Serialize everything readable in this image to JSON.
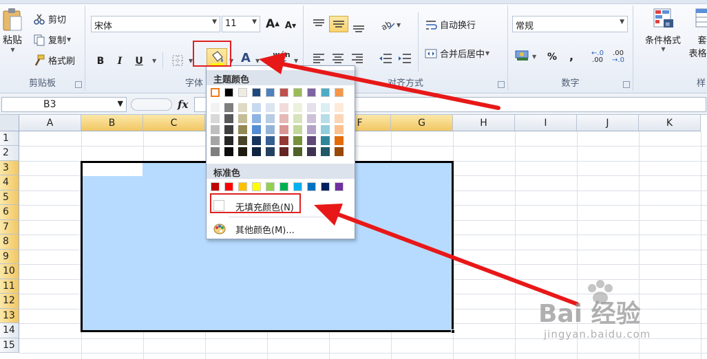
{
  "clipboard": {
    "paste_label": "粘贴",
    "cut_label": "剪切",
    "copy_label": "复制",
    "format_painter_label": "格式刷",
    "group_label": "剪贴板"
  },
  "font_group": {
    "font_name": "宋体",
    "font_size": "11",
    "bold_label": "B",
    "italic_label": "I",
    "underline_label": "U",
    "font_color_label": "A",
    "phonetic_label": "wén",
    "grow_font_label": "A",
    "shrink_font_label": "A",
    "group_label": "字体"
  },
  "alignment_group": {
    "wrap_text_label": "自动换行",
    "merge_center_label": "合并后居中",
    "group_label": "对齐方式"
  },
  "number_group": {
    "format_value": "常规",
    "percent_label": "%",
    "comma_label": ",",
    "inc_decimal_label": ".00",
    "dec_decimal_label": ".00",
    "group_label": "数字"
  },
  "styles_group": {
    "conditional_format_label": "条件格式",
    "table_format_label_1": "套",
    "table_format_label_2": "表格格",
    "group_label": "样"
  },
  "formula_bar": {
    "name_box_value": "B3",
    "fx_label": "fx"
  },
  "grid": {
    "columns": [
      "A",
      "B",
      "C",
      "D",
      "E",
      "F",
      "G",
      "H",
      "I",
      "J",
      "K"
    ],
    "rows": [
      "1",
      "2",
      "3",
      "4",
      "5",
      "6",
      "7",
      "8",
      "9",
      "10",
      "11",
      "12",
      "13",
      "14",
      "15"
    ],
    "selected_columns": [
      "B",
      "C",
      "D",
      "E",
      "F",
      "G"
    ],
    "selected_rows": [
      "3",
      "4",
      "5",
      "6",
      "7",
      "8",
      "9",
      "10",
      "11",
      "12",
      "13"
    ],
    "fill_color": "#b7dbff"
  },
  "color_menu": {
    "theme_colors_header": "主题颜色",
    "standard_colors_header": "标准色",
    "no_fill_label": "无填充颜色(N)",
    "more_colors_label": "其他颜色(M)...",
    "theme_colors": [
      "#ffffff",
      "#000000",
      "#eeece1",
      "#1f497d",
      "#4f81bd",
      "#c0504d",
      "#9bbb59",
      "#8064a2",
      "#4bacc6",
      "#f79646"
    ],
    "theme_shades": [
      [
        "#f2f2f2",
        "#d8d8d8",
        "#bfbfbf",
        "#a5a5a5",
        "#7f7f7f"
      ],
      [
        "#7f7f7f",
        "#595959",
        "#3f3f3f",
        "#262626",
        "#0c0c0c"
      ],
      [
        "#ddd9c3",
        "#c4bd97",
        "#938953",
        "#494429",
        "#1d1b10"
      ],
      [
        "#c6d9f0",
        "#8db3e2",
        "#548dd4",
        "#17365d",
        "#0f243e"
      ],
      [
        "#dbe5f1",
        "#b8cce4",
        "#95b3d7",
        "#366092",
        "#244061"
      ],
      [
        "#f2dcdb",
        "#e5b9b7",
        "#d99694",
        "#953734",
        "#632423"
      ],
      [
        "#ebf1dd",
        "#d7e3bc",
        "#c3d69b",
        "#76923c",
        "#4f6128"
      ],
      [
        "#e5e0ec",
        "#ccc1d9",
        "#b2a2c7",
        "#5f497a",
        "#3f3151"
      ],
      [
        "#dbeef3",
        "#b7dde8",
        "#92cddc",
        "#31859b",
        "#205867"
      ],
      [
        "#fdeada",
        "#fbd5b5",
        "#fac08f",
        "#e36c09",
        "#974806"
      ]
    ],
    "standard_colors": [
      "#c00000",
      "#ff0000",
      "#ffc000",
      "#ffff00",
      "#92d050",
      "#00b050",
      "#00b0f0",
      "#0070c0",
      "#002060",
      "#7030a0"
    ]
  },
  "annotation": {
    "highlight_color": "#e02020"
  },
  "watermark": {
    "brand": "Bai 经验",
    "url": "jingyan.baidu.com"
  }
}
